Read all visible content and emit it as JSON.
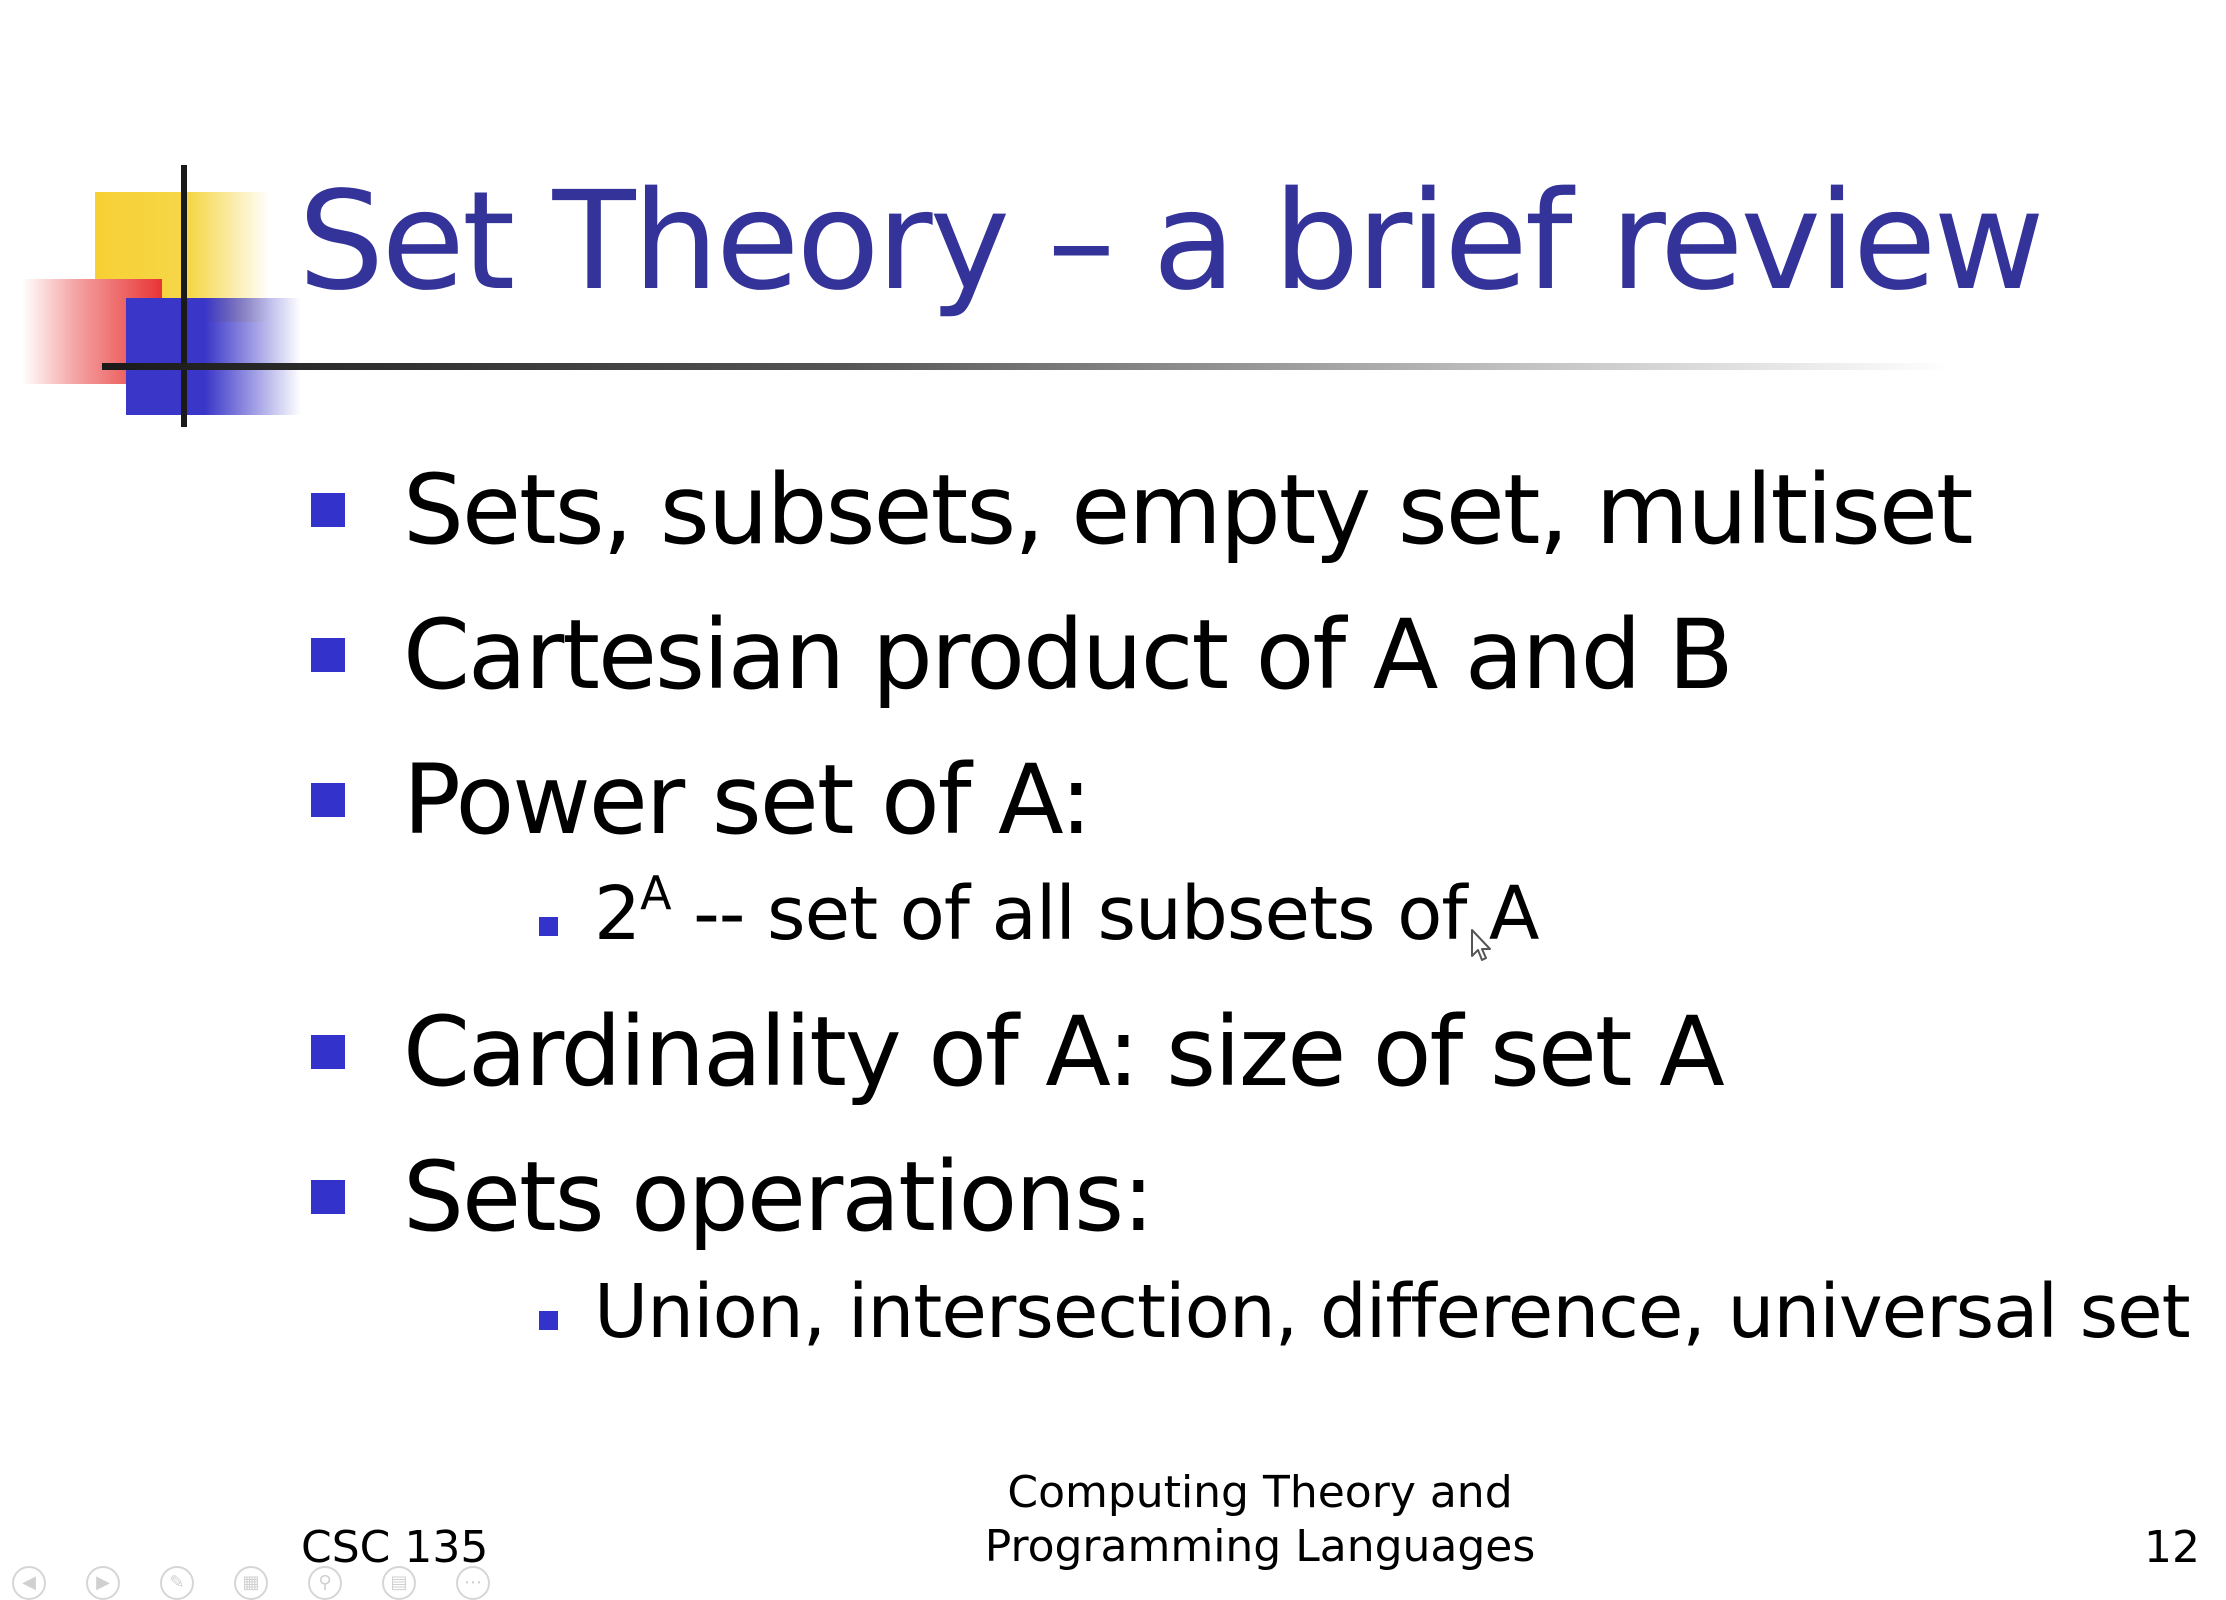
{
  "slide": {
    "title": "Set Theory – a brief review",
    "bullets": [
      "Sets, subsets, empty set, multiset",
      "Cartesian product of A and B",
      "Power set of A:",
      "Cardinality of A: size of set A",
      "Sets operations:"
    ],
    "sub_bullets": {
      "power_set_base": "2",
      "power_set_exponent": "A",
      "power_set_rest": " -- set of all subsets of A",
      "operations": "Union, intersection, difference, universal set"
    },
    "footer": {
      "course": "CSC 135",
      "subject_line1": "Computing Theory and",
      "subject_line2": "Programming Languages",
      "page_number": "12"
    }
  },
  "colors": {
    "title": "#33339a",
    "bullet": "#3333cc",
    "accent_yellow": "#f7d033",
    "accent_red": "#e83434",
    "accent_blue": "#3a36c8"
  },
  "controls": {
    "icons": [
      "previous-slide-icon",
      "next-slide-icon",
      "pen-icon",
      "see-all-slides-icon",
      "zoom-icon",
      "subtitles-icon",
      "more-options-icon"
    ]
  }
}
